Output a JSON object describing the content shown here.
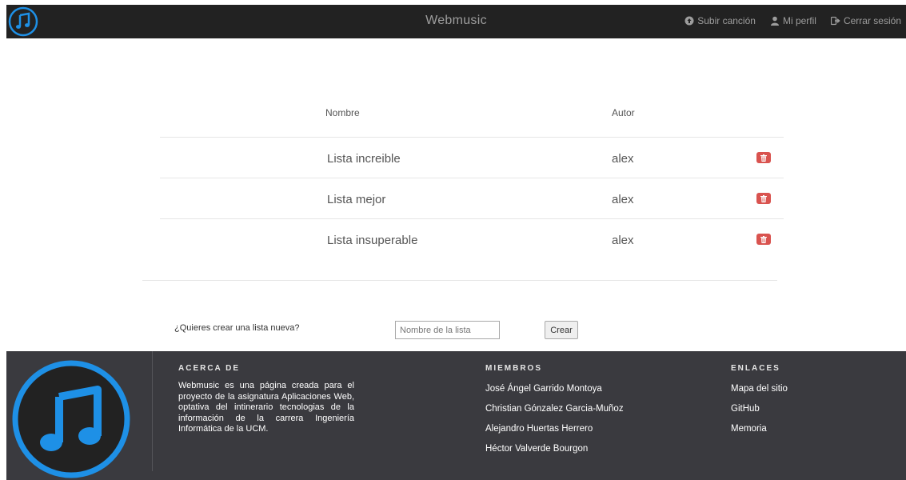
{
  "navbar": {
    "brand": "Webmusic",
    "logo_icon": "music-note-icon",
    "links": [
      {
        "label": "Subir canción",
        "icon": "upload-icon"
      },
      {
        "label": "Mi perfil",
        "icon": "user-icon"
      },
      {
        "label": "Cerrar sesión",
        "icon": "logout-icon"
      }
    ]
  },
  "table": {
    "headers": {
      "name": "Nombre",
      "author": "Autor"
    },
    "rows": [
      {
        "name": "Lista increible",
        "author": "alex"
      },
      {
        "name": "Lista mejor",
        "author": "alex"
      },
      {
        "name": "Lista insuperable",
        "author": "alex"
      }
    ],
    "delete_icon": "trash-icon"
  },
  "create": {
    "question": "¿Quieres crear una lista nueva?",
    "placeholder": "Nombre de la lista",
    "value": "",
    "button": "Crear"
  },
  "footer": {
    "about": {
      "title": "ACERCA DE",
      "text": "Webmusic es una página creada para el proyecto de la asignatura Aplicaciones Web, optativa del intinerario tecnologias de la información de la carrera Ingeniería Informática de la UCM."
    },
    "members": {
      "title": "MIEMBROS",
      "items": [
        "José Ángel Garrido Montoya",
        "Christian Gónzalez Garcia-Muñoz",
        "Alejandro Huertas Herrero",
        "Héctor Valverde Bourgon"
      ]
    },
    "links": {
      "title": "ENLACES",
      "items": [
        "Mapa del sitio",
        "GitHub",
        "Memoria"
      ]
    }
  },
  "colors": {
    "navbar_bg": "#222222",
    "footer_bg": "#3a3a3f",
    "accent_blue": "#1e90e6",
    "danger": "#d9534f"
  }
}
